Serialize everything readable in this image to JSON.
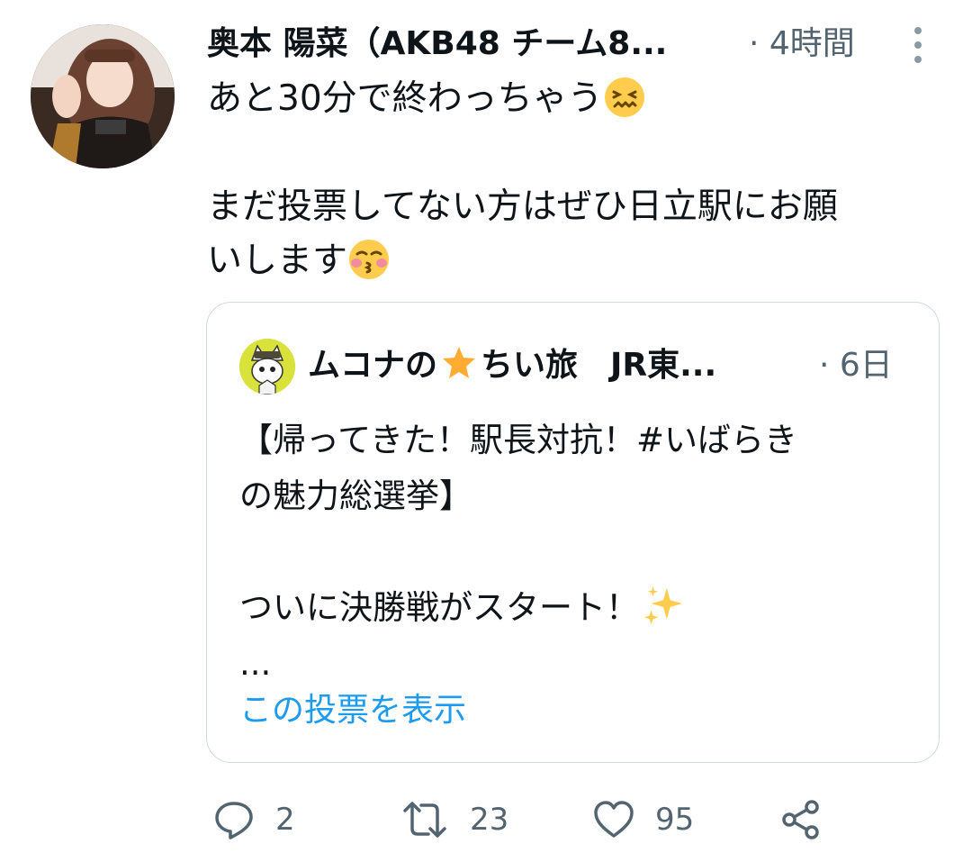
{
  "tweet": {
    "author_name": "奥本 陽菜（AKB48 チーム8...",
    "time": "· 4時間",
    "line1": "あと30分で終わっちゃう",
    "line2": "まだ投票してない方はぜひ日立駅にお願",
    "line3": "いします",
    "emoji1": "confounded-face-emoji",
    "emoji2": "kissing-face-emoji"
  },
  "quote": {
    "author_name_a": "ムコナの",
    "author_name_b": "ちい旅　JR東...",
    "time": "· 6日",
    "line1": "【帰ってきた！駅長対抗！#いばらき",
    "line2": "の魅力総選挙】",
    "line3": "ついに決勝戦がスタート！",
    "line4": "...",
    "link": "この投票を表示"
  },
  "actions": {
    "reply_count": "2",
    "retweet_count": "23",
    "like_count": "95"
  },
  "colors": {
    "text": "#0f1419",
    "muted": "#536471",
    "link": "#1d9bf0",
    "border": "#cfd9de"
  }
}
